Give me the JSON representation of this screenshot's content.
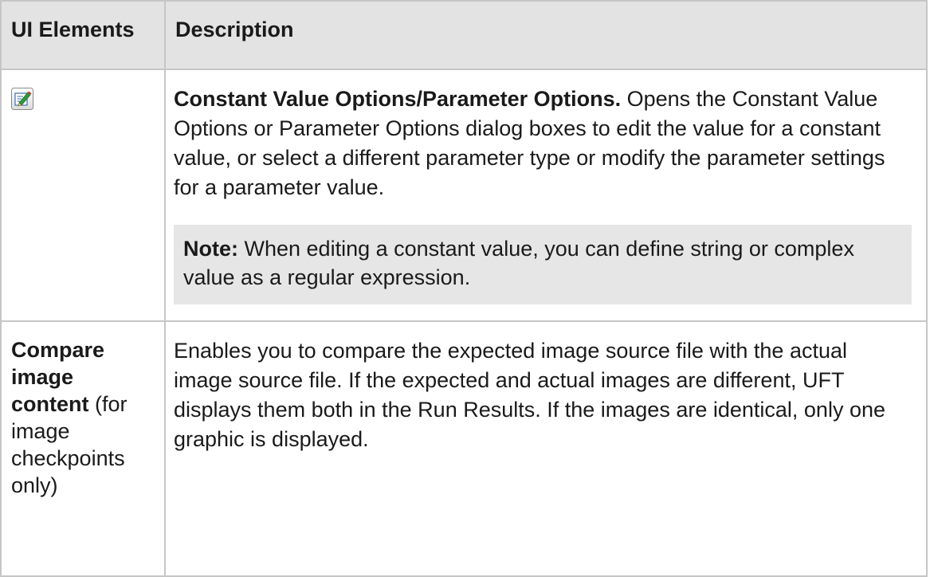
{
  "table": {
    "headers": {
      "ui_elements": "UI Elements",
      "description": "Description"
    },
    "rows": [
      {
        "element_icon": "edit-pencil-icon",
        "description_bold": "Constant Value Options/Parameter Options.",
        "description_text": " Opens the Constant Value Options or Parameter Options dialog boxes to edit the value for a constant value, or select a different parameter type or modify the parameter settings for a parameter value.",
        "note_label": "Note:",
        "note_text": " When editing a constant value, you can define string or complex value as a regular expression."
      },
      {
        "element_bold": "Compare image content",
        "element_normal": " (for image checkpoints only)",
        "description_text": "Enables you to compare the expected image source file with the actual image source file. If the expected and actual images are different, UFT displays them both in the Run Results. If the images are identical, only one graphic is displayed."
      }
    ]
  },
  "colors": {
    "header_bg": "#e3e3e3",
    "note_bg": "#e6e6e6",
    "border": "#c6c6c6"
  }
}
